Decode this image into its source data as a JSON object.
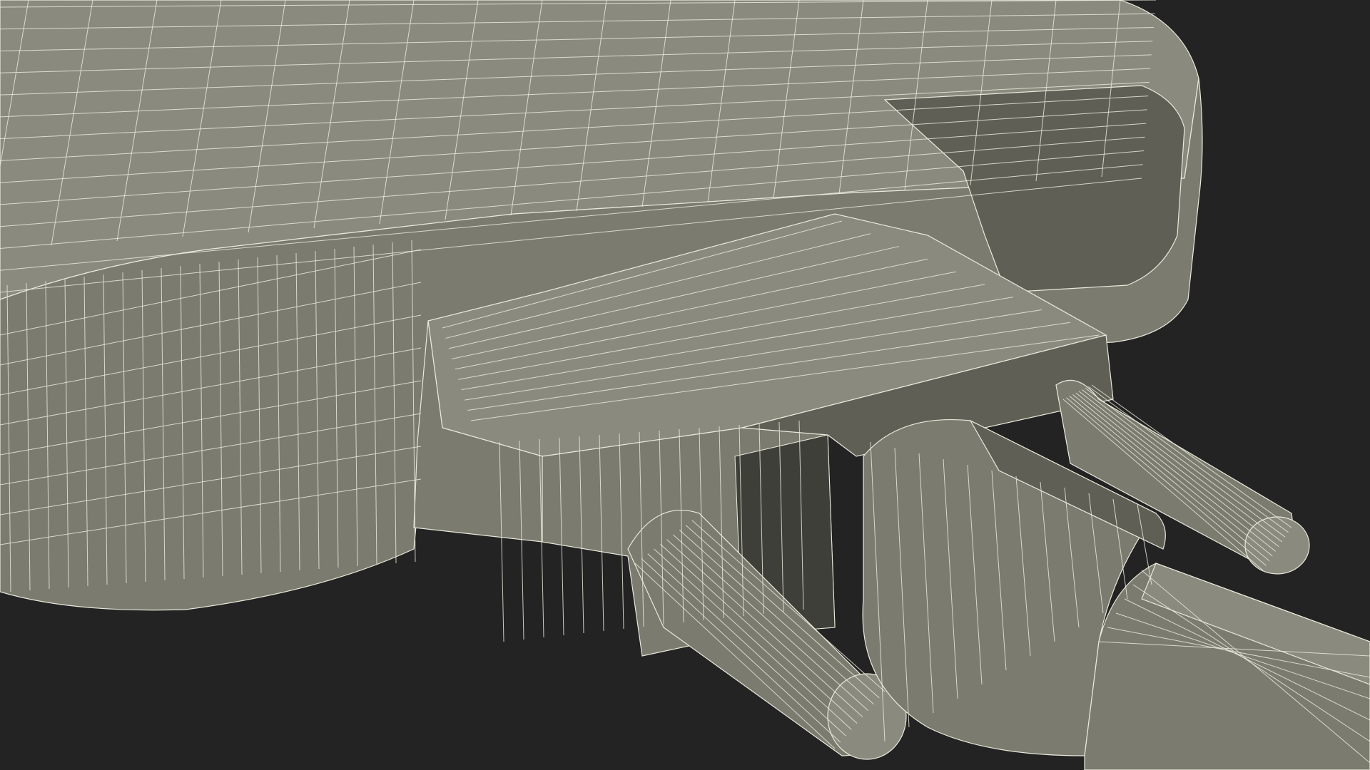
{
  "scene": {
    "subject": "wireframe-3d-model",
    "colors": {
      "background": "#232323",
      "surface": "#7b7b6f",
      "surface_light": "#8a8a7e",
      "surface_dark": "#5f5f55",
      "shadow": "#3f3f3a",
      "wire": "#e9e9dc"
    }
  }
}
